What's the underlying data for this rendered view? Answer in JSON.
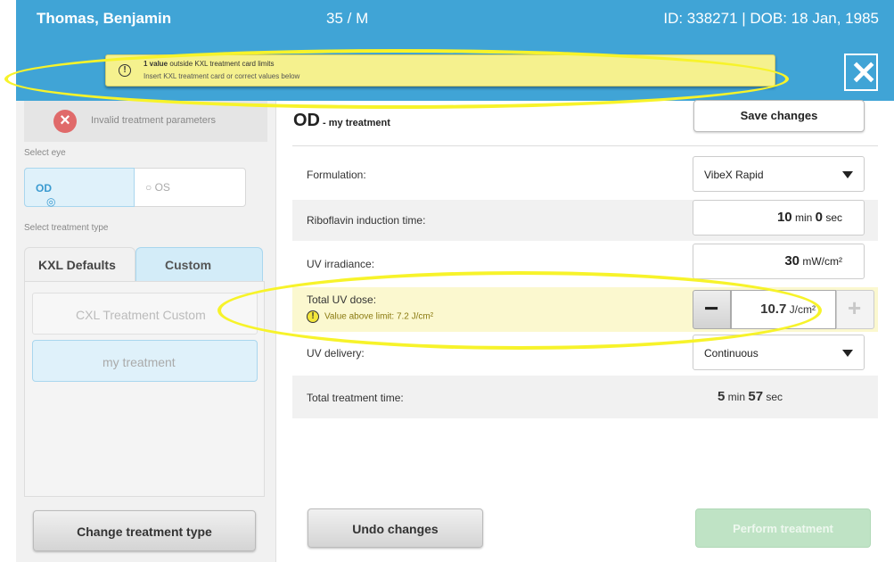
{
  "header": {
    "patient_name": "Thomas, Benjamin",
    "age_sex": "35 / M",
    "id_dob": "ID: 338271 | DOB: 18 Jan, 1985"
  },
  "alert": {
    "bold": "1 value",
    "line1_rest": " outside KXL treatment card limits",
    "line2": "Insert KXL treatment card or correct values below",
    "close_glyph": "✕"
  },
  "left": {
    "status_text": "Invalid treatment parameters",
    "select_eye_label": "Select eye",
    "eye_od": "OD",
    "eye_os": "OS",
    "select_type_label": "Select treatment type",
    "tab_kxl": "KXL Defaults",
    "tab_custom": "Custom",
    "items": [
      "CXL Treatment Custom",
      "my treatment"
    ],
    "change_button": "Change treatment type"
  },
  "main": {
    "eye": "OD",
    "treatment_name": " - my treatment",
    "save_button": "Save changes",
    "rows": {
      "formulation_label": "Formulation:",
      "formulation_value": "VibeX Rapid",
      "induction_label": "Riboflavin induction time:",
      "induction_min": "10",
      "induction_min_unit": " min ",
      "induction_sec": "0",
      "induction_sec_unit": " sec",
      "irradiance_label": "UV irradiance:",
      "irradiance_value": "30",
      "irradiance_unit": "  mW/cm²",
      "dose_label": "Total UV dose:",
      "dose_warning": "Value above limit:  7.2 J/cm²",
      "dose_value": "10.7",
      "dose_unit": "  J/cm²",
      "delivery_label": "UV delivery:",
      "delivery_value": "Continuous",
      "total_time_label": "Total treatment time:",
      "total_min": "5",
      "total_min_unit": " min ",
      "total_sec": "57",
      "total_sec_unit": " sec"
    },
    "undo_button": "Undo changes",
    "perform_button": "Perform treatment"
  },
  "colors": {
    "header_blue": "#40a4d6",
    "alert_yellow": "#f5f18e",
    "annotation_yellow": "#f7f32a",
    "perform_green": "#bfe3c5"
  }
}
